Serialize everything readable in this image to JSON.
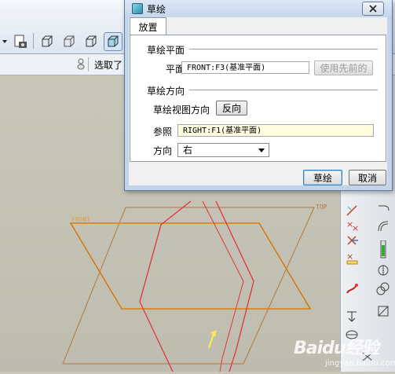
{
  "dialog": {
    "title": "草绘",
    "tab": "放置",
    "plane_section": "草绘平面",
    "plane_label": "平面",
    "plane_value": "FRONT:F3(基准平面)",
    "use_previous_button": "使用先前的",
    "orientation_section": "草绘方向",
    "view_direction_label": "草绘视图方向",
    "flip_button": "反向",
    "reference_label": "参照",
    "reference_value": "RIGHT:F1(基准平面)",
    "direction_label": "方向",
    "direction_value": "右",
    "sketch_button": "草绘",
    "cancel_button": "取消"
  },
  "app": {
    "filter_label": "选取了"
  },
  "canvas": {
    "front_label": "FRONT",
    "top_label": "TOP"
  },
  "watermark": {
    "brand": "Baidu经验",
    "sub": "jingyan.baidu.com"
  },
  "colors": {
    "front_plane": "#e8a03c",
    "top_plane": "#c8874a",
    "right_plane": "#e0353a",
    "arrow": "#ffe84a"
  }
}
